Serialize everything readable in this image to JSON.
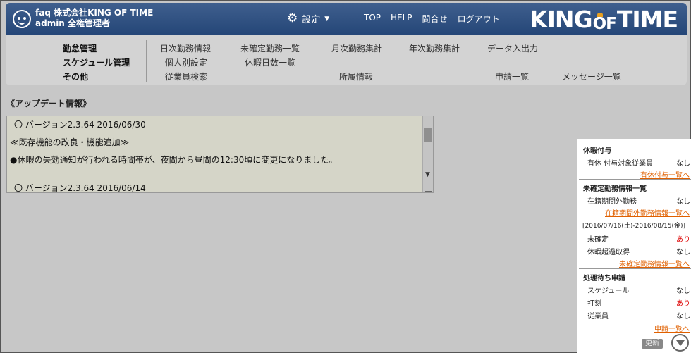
{
  "header": {
    "account_line1": "faq 株式会社KING OF TIME",
    "account_line2": "admin 全権管理者",
    "settings_label": "設定",
    "topnav": [
      "TOP",
      "HELP",
      "問合せ",
      "ログアウト"
    ],
    "brand_king": "KING",
    "brand_of": "OF",
    "brand_time": "TIME"
  },
  "menu": {
    "categories": [
      "勤怠管理",
      "スケジュール管理",
      "その他"
    ],
    "row1": [
      "日次勤務情報",
      "未確定勤務一覧",
      "月次勤務集計",
      "年次勤務集計",
      "データ入出力"
    ],
    "row2": [
      "個人別設定",
      "休暇日数一覧"
    ],
    "row3": [
      "従業員検索",
      "所属情報",
      "申請一覧",
      "メッセージ一覧"
    ]
  },
  "updates": {
    "title": "《アップデート情報》",
    "lines": [
      "〇 バージョン2.3.64  2016/06/30",
      "≪既存機能の改良・機能追加≫",
      "●休暇の失効通知が行われる時間帯が、夜間から昼間の12:30頃に変更になりました。",
      "〇 バージョン2.3.64  2016/06/14"
    ]
  },
  "side": {
    "leave_title": "休暇付与",
    "leave_row": "有休 付与対象従業員",
    "leave_val": "なし",
    "leave_link": "有休付与一覧へ",
    "unconfirmed_title": "未確定勤務情報一覧",
    "outside_row": "在籍期間外勤務",
    "outside_val": "なし",
    "outside_link": "在籍期間外勤務情報一覧へ",
    "range": "[2016/07/16(土)-2016/08/15(金)]",
    "unconfirmed_row": "未確定",
    "unconfirmed_val": "あり",
    "overuse_row": "休暇超過取得",
    "overuse_val": "なし",
    "unconfirmed_link": "未確定勤務情報一覧へ",
    "pending_title": "処理待ち申請",
    "pending_rows": [
      "スケジュール",
      "打刻",
      "従業員"
    ],
    "pending_vals": [
      "なし",
      "あり",
      "なし"
    ],
    "pending_link": "申請一覧へ",
    "update_label": "更新"
  }
}
